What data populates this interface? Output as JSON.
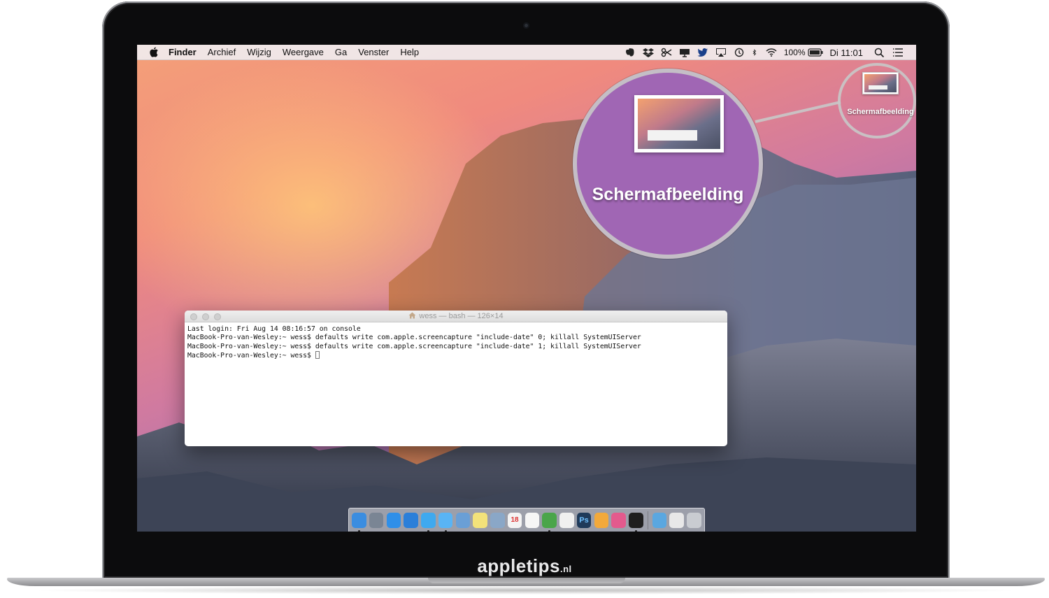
{
  "menubar": {
    "app_name": "Finder",
    "menus": [
      "Archief",
      "Wijzig",
      "Weergave",
      "Ga",
      "Venster",
      "Help"
    ],
    "status_icons": [
      "evernote-icon",
      "dropbox-icon",
      "scissors-icon",
      "screen-icon",
      "twitter-icon",
      "airplay-icon",
      "time-machine-icon",
      "bluetooth-icon",
      "wifi-icon"
    ],
    "battery": "100%",
    "clock": "Di 11:01"
  },
  "desktop": {
    "file_label": "Schermafbeelding",
    "zoom_label": "Schermafbeelding"
  },
  "terminal": {
    "title": "wess — bash — 126×14",
    "lines": [
      "Last login: Fri Aug 14 08:16:57 on console",
      "MacBook-Pro-van-Wesley:~ wess$ defaults write com.apple.screencapture \"include-date\" 0; killall SystemUIServer",
      "MacBook-Pro-van-Wesley:~ wess$ defaults write com.apple.screencapture \"include-date\" 1; killall SystemUIServer",
      "MacBook-Pro-van-Wesley:~ wess$ "
    ]
  },
  "dock": {
    "apps": [
      {
        "name": "finder-icon",
        "color": "#3b8de0",
        "running": true
      },
      {
        "name": "launchpad-icon",
        "color": "#7a8594",
        "running": false
      },
      {
        "name": "app-store-icon",
        "color": "#2f8fe8",
        "running": false
      },
      {
        "name": "safari-icon",
        "color": "#2b7fd9",
        "running": false
      },
      {
        "name": "twitter-icon",
        "color": "#3fa9ef",
        "running": true
      },
      {
        "name": "messages-icon",
        "color": "#59b4f5",
        "running": true
      },
      {
        "name": "mail-icon",
        "color": "#6a9fd6",
        "running": false
      },
      {
        "name": "notes-icon",
        "color": "#f3e27a",
        "running": false
      },
      {
        "name": "preview-icon",
        "color": "#8aa7c7",
        "running": false
      },
      {
        "name": "calendar-icon",
        "color": "#f4f4f4",
        "running": false
      },
      {
        "name": "reminders-icon",
        "color": "#f6f6f6",
        "running": false
      },
      {
        "name": "evernote-icon",
        "color": "#4aa54a",
        "running": true
      },
      {
        "name": "photos-icon",
        "color": "#f0f0f0",
        "running": false
      },
      {
        "name": "photoshop-icon",
        "color": "#1f3a5a",
        "running": false
      },
      {
        "name": "pages-icon",
        "color": "#f2a93b",
        "running": false
      },
      {
        "name": "itunes-icon",
        "color": "#e35a8d",
        "running": false
      },
      {
        "name": "terminal-icon",
        "color": "#1e1e1e",
        "running": true
      }
    ],
    "right": [
      {
        "name": "folder-icon",
        "color": "#5aa7e0"
      },
      {
        "name": "downloads-icon",
        "color": "#e8e8e8"
      },
      {
        "name": "trash-icon",
        "color": "#c9ccd1"
      }
    ],
    "calendar_day": "18",
    "photoshop_label": "Ps"
  },
  "brand": {
    "name": "appletips",
    "tld": ".nl"
  }
}
